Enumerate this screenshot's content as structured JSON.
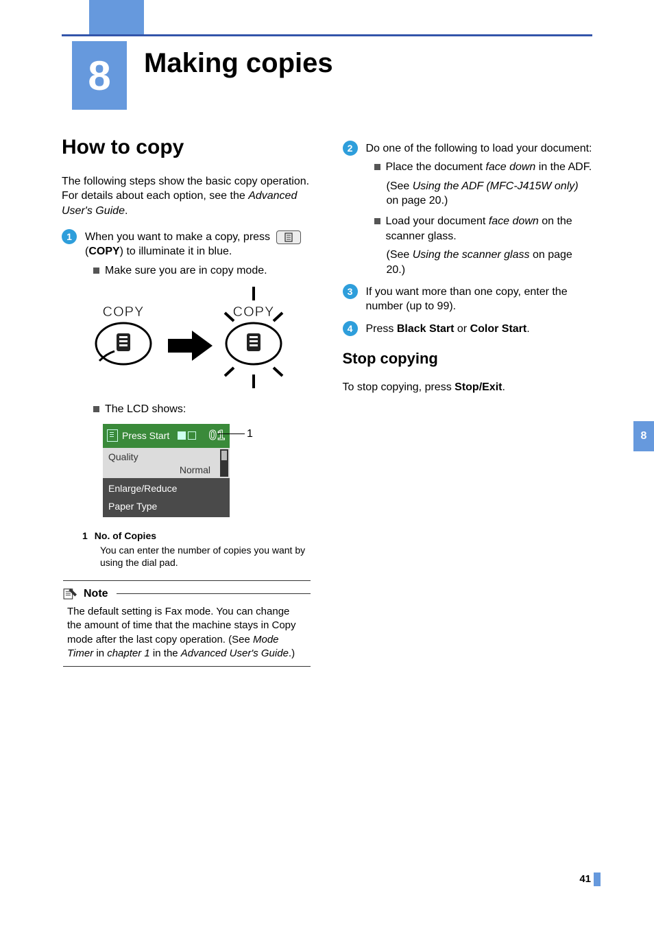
{
  "chapter": {
    "number": "8",
    "title": "Making copies"
  },
  "sidebarTab": "8",
  "pageNumber": "41",
  "left": {
    "h2": "How to copy",
    "intro_a": "The following steps show the basic copy operation. For details about each option, see the ",
    "intro_em": "Advanced User's Guide",
    "intro_b": ".",
    "step1": {
      "line1_a": "When you want to make a copy, press ",
      "copy_word": "COPY",
      "line1_b": ") to illuminate it in blue.",
      "bullet1": "Make sure you are in copy mode.",
      "btn_label_left": "COPY",
      "btn_label_right": "COPY",
      "bullet2": "The LCD shows:"
    },
    "lcd": {
      "header_text": "Press Start",
      "count": "01",
      "quality_label": "Quality",
      "quality_value": "Normal",
      "row2": "Enlarge/Reduce",
      "row3": "Paper Type"
    },
    "callout": "1",
    "legend": {
      "num": "1",
      "title": "No. of Copies",
      "body": "You can enter the number of copies you want by using the dial pad."
    },
    "note": {
      "label": "Note",
      "a": "The default setting is Fax mode. You can change the amount of time that the machine stays in Copy mode after the last copy operation. (See ",
      "em1": "Mode Timer",
      "b": " in ",
      "em2": "chapter 1",
      "c": " in the ",
      "em3": "Advanced User's Guide",
      "d": ".)"
    }
  },
  "right": {
    "step2": {
      "intro": "Do one of the following to load your document:",
      "b1_a": "Place the document ",
      "b1_em": "face down",
      "b1_b": " in the ADF.",
      "b1_sub_a": "(See ",
      "b1_sub_em": "Using the ADF  (MFC-J415W only)",
      "b1_sub_b": " on page 20.)",
      "b2_a": "Load your document ",
      "b2_em": "face down",
      "b2_b": " on the scanner glass.",
      "b2_sub_a": "(See ",
      "b2_sub_em": "Using the scanner glass",
      "b2_sub_b": " on page 20.)"
    },
    "step3": "If you want more than one copy, enter the number (up to 99).",
    "step4_a": "Press ",
    "step4_b1": "Black Start",
    "step4_mid": " or ",
    "step4_b2": "Color Start",
    "step4_end": ".",
    "h3": "Stop copying",
    "stop_a": "To stop copying, press ",
    "stop_b": "Stop/Exit",
    "stop_c": "."
  }
}
